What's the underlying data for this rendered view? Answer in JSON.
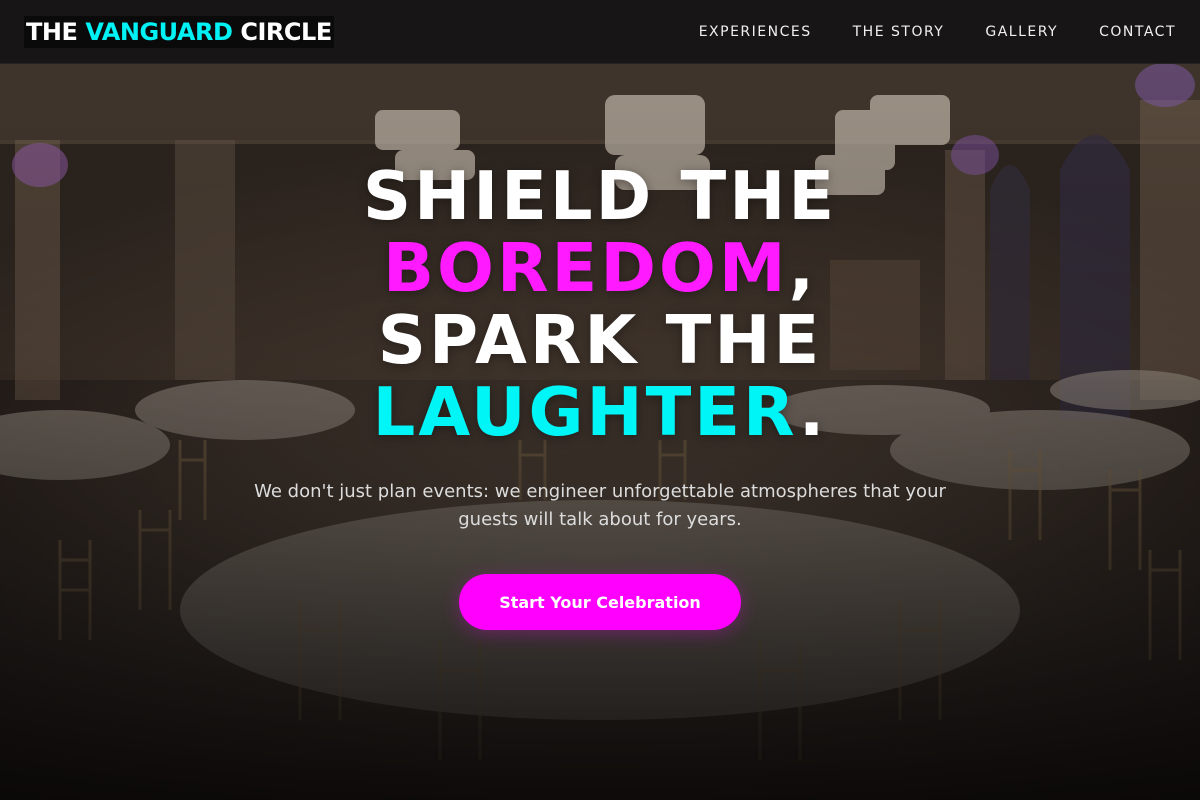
{
  "header": {
    "logo": {
      "part1": "THE",
      "accent": "VANGUARD",
      "part2": "CIRCLE"
    },
    "nav": [
      {
        "label": "EXPERIENCES"
      },
      {
        "label": "THE STORY"
      },
      {
        "label": "GALLERY"
      },
      {
        "label": "CONTACT"
      }
    ]
  },
  "hero": {
    "headline": {
      "line1": "SHIELD THE",
      "line2_accent": "BOREDOM",
      "line2_suffix": ",",
      "line3": "SPARK THE",
      "line4_accent": "LAUGHTER",
      "line4_suffix": "."
    },
    "subtitle": "We don't just plan events: we engineer unforgettable atmospheres that your guests will talk about for years.",
    "cta_label": "Start Your Celebration"
  },
  "colors": {
    "accent_magenta": "#ff00ff",
    "accent_cyan": "#00f2f5",
    "header_bg": "#181616"
  }
}
